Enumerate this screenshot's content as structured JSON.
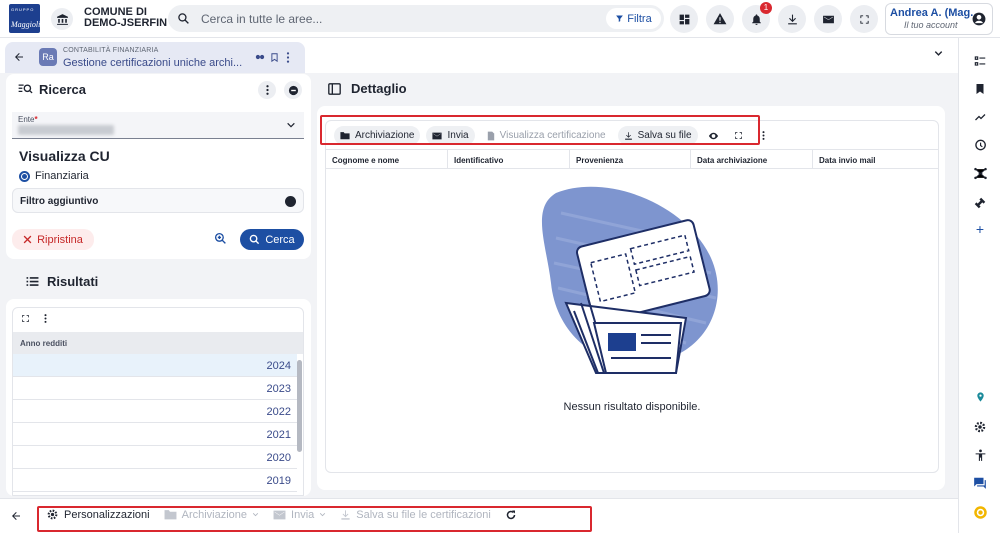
{
  "header": {
    "logo_top": "GRUPPO",
    "logo_bottom": "Maggioli",
    "municipality_line1": "COMUNE DI",
    "municipality_line2": "DEMO-JSERFIN",
    "search_placeholder": "Cerca in tutte le aree...",
    "filter_label": "Filtra",
    "notifications_count": "1",
    "user_name": "Andrea A. (Mag...",
    "user_sub": "Il tuo account"
  },
  "tab": {
    "supertitle": "CONTABILITÀ FINANZIARIA",
    "title": "Gestione certificazioni uniche archi...",
    "icon_text": "Ra"
  },
  "ricerca": {
    "title": "Ricerca",
    "ente_label": "Ente",
    "section_title": "Visualizza CU",
    "radio_option": "Finanziaria",
    "filter_label": "Filtro aggiuntivo",
    "reset_label": "Ripristina",
    "search_label": "Cerca"
  },
  "risultati": {
    "title": "Risultati",
    "column": "Anno redditi",
    "years": [
      "2024",
      "2023",
      "2022",
      "2021",
      "2020",
      "2019"
    ]
  },
  "dettaglio": {
    "title": "Dettaglio",
    "toolbar": {
      "archiviazione": "Archiviazione",
      "invia": "Invia",
      "visualizza": "Visualizza certificazione",
      "salva": "Salva su file"
    },
    "columns": [
      "Cognome e nome",
      "Identificativo",
      "Provenienza",
      "Data archiviazione",
      "Data invio mail"
    ],
    "empty_message": "Nessun risultato disponibile."
  },
  "bottom_bar": {
    "personalizzazioni": "Personalizzazioni",
    "archiviazione": "Archiviazione",
    "invia": "Invia",
    "salva": "Salva su file le certificazioni"
  },
  "colors": {
    "accent": "#1d4fa3",
    "highlight_border": "#d9282f",
    "badge": "#d9282f"
  }
}
